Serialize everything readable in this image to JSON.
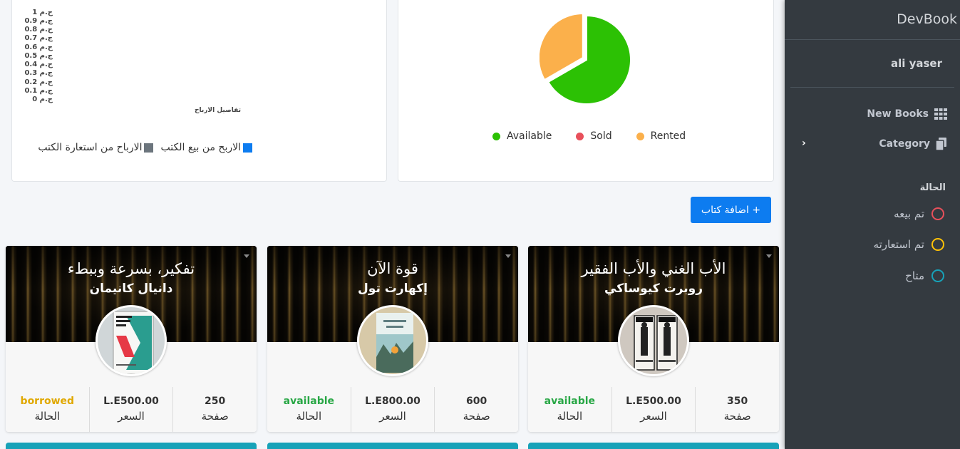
{
  "bar_chart": {
    "y_ticks": [
      "1 ج.م",
      "0.9 ج.م",
      "0.8 ج.م",
      "0.7 ج.م",
      "0.6 ج.م",
      "0.5 ج.م",
      "0.4 ج.م",
      "0.3 ج.م",
      "0.2 ج.م",
      "0.1 ج.م",
      "0 ج.م"
    ],
    "x_label": "تفاصيل الارباح",
    "legend": [
      {
        "label": "الاربح من بيع الكتب",
        "color": "#0d7cf0"
      },
      {
        "label": "الارباح من استعارة الكتب",
        "color": "#6c757d"
      }
    ]
  },
  "chart_data": [
    {
      "type": "bar",
      "xlabel": "تفاصيل الارباح",
      "ylim": [
        0,
        1
      ],
      "y_ticks": [
        "0 ج.م",
        "0.1 ج.م",
        "0.2 ج.م",
        "0.3 ج.م",
        "0.4 ج.م",
        "0.5 ج.م",
        "0.6 ج.م",
        "0.7 ج.م",
        "0.8 ج.م",
        "0.9 ج.م",
        "1 ج.م"
      ],
      "series": [
        {
          "name": "الاربح من بيع الكتب",
          "values": []
        },
        {
          "name": "الارباح من استعارة الكتب",
          "values": []
        }
      ],
      "legend": "bottom"
    },
    {
      "type": "pie",
      "categories": [
        "Available",
        "Sold",
        "Rented"
      ],
      "values": [
        2,
        0,
        1
      ],
      "colors": [
        "#2cc104",
        "#e8505b",
        "#fbb04b"
      ],
      "legend": "bottom"
    }
  ],
  "pie_legend": [
    {
      "label": "Available",
      "color": "#2cc104"
    },
    {
      "label": "Sold",
      "color": "#e8505b"
    },
    {
      "label": "Rented",
      "color": "#fbb04b"
    }
  ],
  "add_button": "+ اضافة كتاب",
  "books": [
    {
      "title": "الأب الغني والأب الفقير",
      "author": "روبرت كيوساكي",
      "pages": "350",
      "pages_label": "صفحة",
      "price": "L.E500.00",
      "price_label": "السعر",
      "status": "available",
      "status_label": "الحالة"
    },
    {
      "title": "قوة الآن",
      "author": "إكهارت تول",
      "pages": "600",
      "pages_label": "صفحة",
      "price": "L.E800.00",
      "price_label": "السعر",
      "status": "available",
      "status_label": "الحالة"
    },
    {
      "title": "تفكير، بسرعة وببطء",
      "author": "دانيال كانيمان",
      "pages": "250",
      "pages_label": "صفحة",
      "price": "L.E500.00",
      "price_label": "السعر",
      "status": "borrowed",
      "status_label": "الحالة"
    }
  ],
  "sidebar": {
    "brand": "DevBook",
    "user": "ali yaser",
    "nav": [
      {
        "label": "New Books",
        "icon": "grid-icon"
      },
      {
        "label": "Category",
        "icon": "copy-icon"
      }
    ],
    "section": "الحالة",
    "statuses": [
      {
        "label": "تم بيعه",
        "color": "#e8505b"
      },
      {
        "label": "تم استعارته",
        "color": "#ffc107"
      },
      {
        "label": "متاح",
        "color": "#17a2b8"
      }
    ]
  }
}
